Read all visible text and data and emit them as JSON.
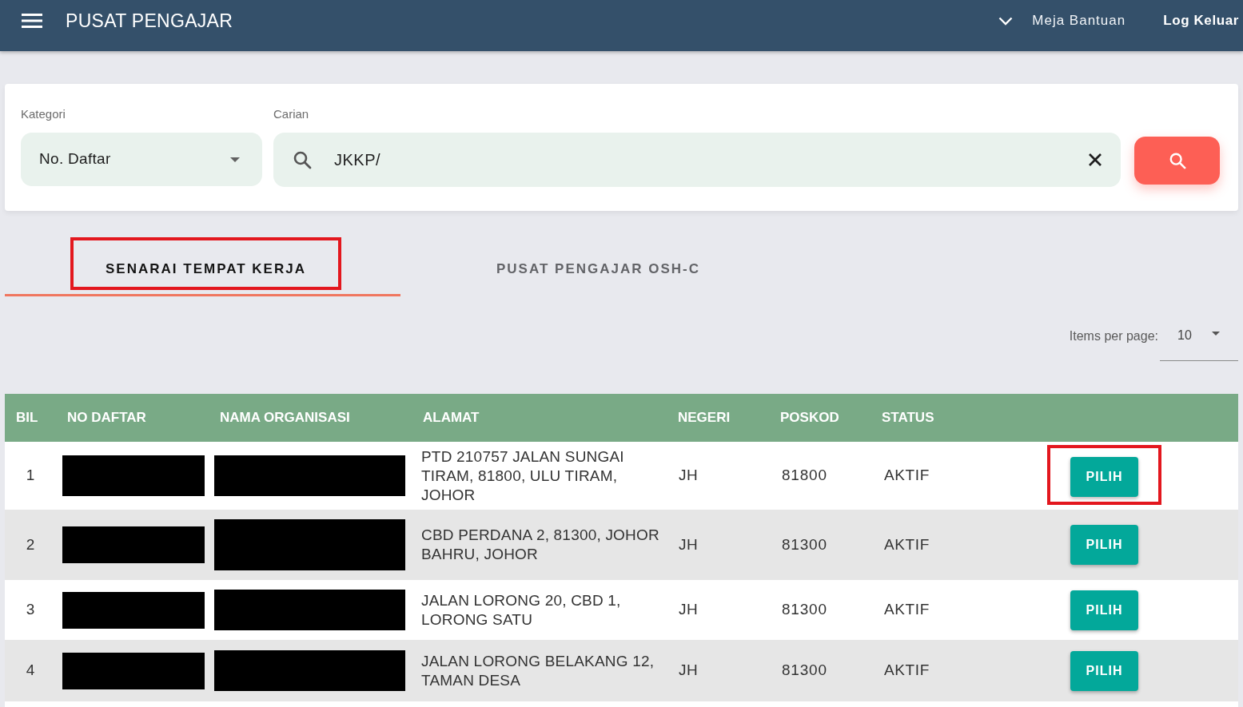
{
  "header": {
    "title": "PUSAT PENGAJAR",
    "links": [
      {
        "label": "Meja Bantuan",
        "kind": "help"
      },
      {
        "label": "Log Keluar",
        "kind": "logout"
      }
    ]
  },
  "search_panel": {
    "category": {
      "label": "Kategori",
      "value": "No. Daftar"
    },
    "search": {
      "label": "Carian",
      "value": "JKKP/"
    }
  },
  "tabs": [
    {
      "label": "SENARAI TEMPAT KERJA",
      "selected": true,
      "highlighted": true
    },
    {
      "label": "PUSAT PENGAJAR OSH-C",
      "selected": false,
      "highlighted": false
    }
  ],
  "pagination": {
    "label": "Items per page:",
    "value": "10"
  },
  "table": {
    "columns": [
      "BIL",
      "NO DAFTAR",
      "NAMA ORGANISASI",
      "ALAMAT",
      "NEGERI",
      "POSKOD",
      "STATUS"
    ],
    "rows": [
      {
        "bil": "1",
        "no_daftar_redacted": true,
        "nama_organisasi_redacted": true,
        "alamat": "PTD 210757 JALAN SUNGAI TIRAM, 81800, ULU TIRAM, JOHOR",
        "negeri": "JH",
        "poskod": "81800",
        "status": "AKTIF",
        "action": "PILIH",
        "highlighted": true
      },
      {
        "bil": "2",
        "no_daftar_redacted": true,
        "nama_organisasi_redacted": true,
        "alamat": "CBD PERDANA 2, 81300, JOHOR BAHRU, JOHOR",
        "negeri": "JH",
        "poskod": "81300",
        "status": "AKTIF",
        "action": "PILIH",
        "highlighted": false
      },
      {
        "bil": "3",
        "no_daftar_redacted": true,
        "nama_organisasi_redacted": true,
        "alamat": "JALAN LORONG 20, CBD 1, LORONG SATU",
        "negeri": "JH",
        "poskod": "81300",
        "status": "AKTIF",
        "action": "PILIH",
        "highlighted": false
      },
      {
        "bil": "4",
        "no_daftar_redacted": true,
        "nama_organisasi_redacted": true,
        "alamat": "JALAN LORONG BELAKANG 12, TAMAN DESA",
        "negeri": "JH",
        "poskod": "81300",
        "status": "AKTIF",
        "action": "PILIH",
        "highlighted": false
      }
    ]
  }
}
